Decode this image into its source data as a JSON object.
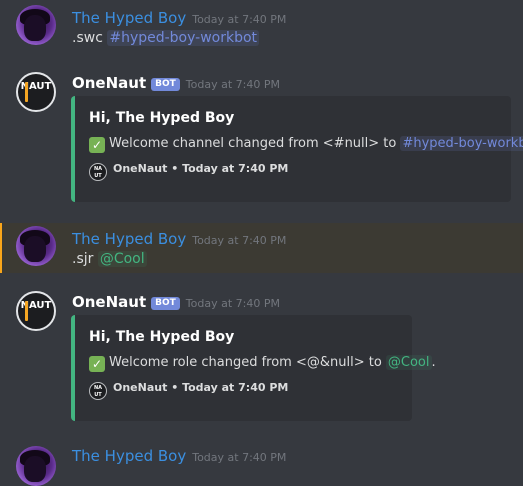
{
  "messages": [
    {
      "author": "The Hyped Boy",
      "timestamp": "Today at 7:40 PM",
      "content_prefix": ".swc ",
      "mention": "#hyped-boy-workbot"
    },
    {
      "author": "OneNaut",
      "bot_tag": "BOT",
      "timestamp": "Today at 7:40 PM",
      "embed": {
        "title": "Hi, The Hyped Boy",
        "check": "✓",
        "desc_prefix": "Welcome channel changed from <#null> to ",
        "desc_mention": "#hyped-boy-workbot",
        "desc_suffix": ".",
        "footer_name": "OneNaut",
        "footer_sep": " • ",
        "footer_time": "Today at 7:40 PM"
      }
    },
    {
      "author": "The Hyped Boy",
      "timestamp": "Today at 7:40 PM",
      "content_prefix": ".sjr ",
      "mention": "@Cool"
    },
    {
      "author": "OneNaut",
      "bot_tag": "BOT",
      "timestamp": "Today at 7:40 PM",
      "embed": {
        "title": "Hi, The Hyped Boy",
        "check": "✓",
        "desc_prefix": "Welcome role changed from <@&null> to ",
        "desc_mention": "@Cool",
        "desc_suffix": ".",
        "footer_name": "OneNaut",
        "footer_sep": " • ",
        "footer_time": "Today at 7:40 PM"
      }
    },
    {
      "author": "The Hyped Boy",
      "timestamp": "Today at 7:40 PM"
    }
  ],
  "bot_logo_text": "NAUT",
  "colors": {
    "background": "#36393f",
    "embed_accent": "#43b581",
    "user_name": "#3b8fe0",
    "mention": "#7289da",
    "highlight_bar": "#faa61a"
  }
}
